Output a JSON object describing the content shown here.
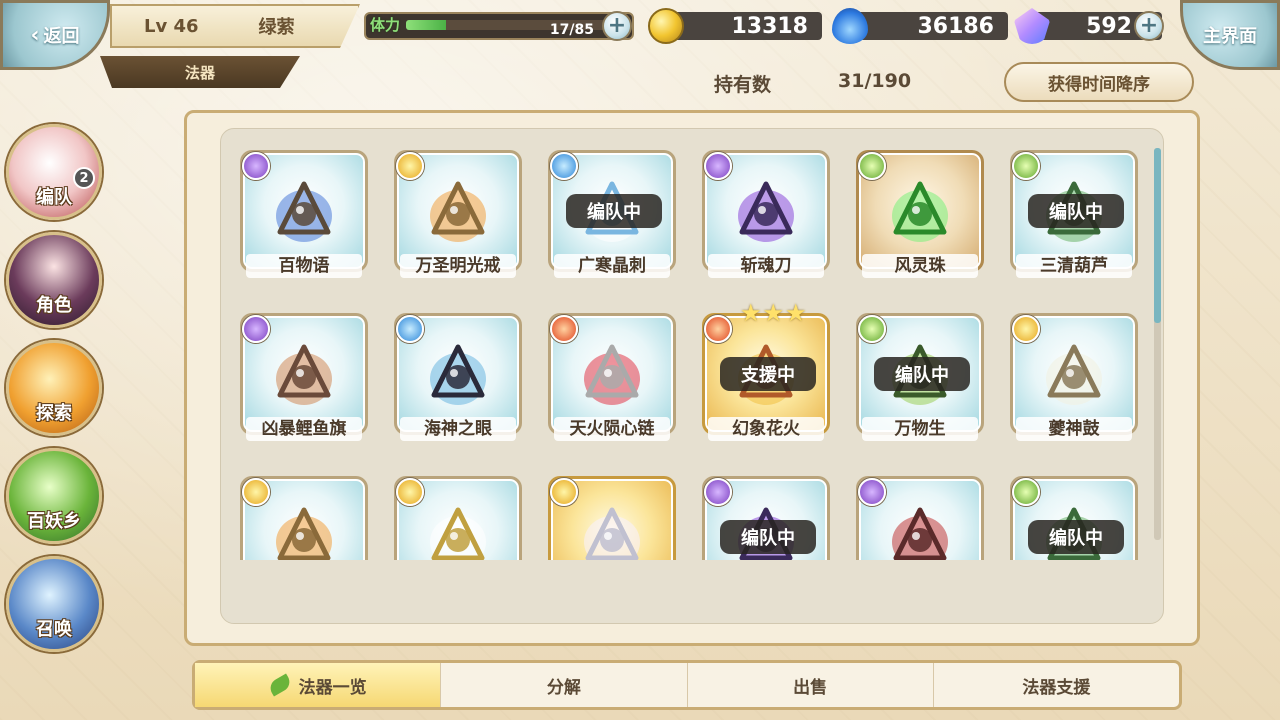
{
  "header": {
    "back_label": "返回",
    "level": "Lv 46",
    "player_name": "绿萦",
    "section_title": "法器",
    "stamina_label": "体力",
    "stamina_value": "17/85",
    "stamina_fraction": 0.2,
    "gold": "13318",
    "soul": "36186",
    "crystal": "592",
    "main_label": "主界面"
  },
  "toolbar": {
    "holdings_label": "持有数",
    "holdings_value": "31/190",
    "sort_label": "获得时间降序"
  },
  "sidebar": {
    "items": [
      {
        "label": "编队",
        "icon": "team-icon",
        "badge": "2"
      },
      {
        "label": "角色",
        "icon": "character-icon"
      },
      {
        "label": "探索",
        "icon": "explore-icon"
      },
      {
        "label": "百妖乡",
        "icon": "village-icon"
      },
      {
        "label": "召唤",
        "icon": "summon-icon"
      }
    ]
  },
  "items": [
    {
      "name": "百物语",
      "element": "dark",
      "status": "",
      "icon": "candle-icon",
      "frame": "blue"
    },
    {
      "name": "万圣明光戒",
      "element": "light",
      "status": "",
      "icon": "ring-icon",
      "frame": "blue"
    },
    {
      "name": "广寒晶刺",
      "element": "water",
      "status": "编队中",
      "icon": "ice-spike-icon",
      "frame": "blue"
    },
    {
      "name": "斩魂刀",
      "element": "dark",
      "status": "",
      "icon": "blade-icon",
      "frame": "blue"
    },
    {
      "name": "风灵珠",
      "element": "wind",
      "status": "",
      "icon": "orb-icon",
      "frame": "tan"
    },
    {
      "name": "三清葫芦",
      "element": "wind",
      "status": "编队中",
      "icon": "gourd-icon",
      "frame": "blue"
    },
    {
      "name": "凶暴鲤鱼旗",
      "element": "dark",
      "status": "",
      "icon": "carp-flag-icon",
      "frame": "blue"
    },
    {
      "name": "海神之眼",
      "element": "water",
      "status": "",
      "icon": "eye-icon",
      "frame": "blue"
    },
    {
      "name": "天火陨心链",
      "element": "fire",
      "status": "",
      "icon": "chain-icon",
      "frame": "blue"
    },
    {
      "name": "幻象花火",
      "element": "fire",
      "status": "支援中",
      "icon": "firework-icon",
      "frame": "gold",
      "stars": "★★★"
    },
    {
      "name": "万物生",
      "element": "wind",
      "status": "编队中",
      "icon": "sprout-icon",
      "frame": "blue"
    },
    {
      "name": "夔神鼓",
      "element": "light",
      "status": "",
      "icon": "drum-icon",
      "frame": "blue"
    },
    {
      "name": "",
      "element": "light",
      "status": "",
      "icon": "ring-icon",
      "frame": "blue"
    },
    {
      "name": "",
      "element": "light",
      "status": "",
      "icon": "sun-mirror-icon",
      "frame": "blue"
    },
    {
      "name": "",
      "element": "light",
      "status": "",
      "icon": "pendant-icon",
      "frame": "gold"
    },
    {
      "name": "",
      "element": "dark",
      "status": "编队中",
      "icon": "blade-icon",
      "frame": "blue"
    },
    {
      "name": "",
      "element": "dark",
      "status": "",
      "icon": "boot-icon",
      "frame": "blue"
    },
    {
      "name": "",
      "element": "wind",
      "status": "编队中",
      "icon": "gourd-icon",
      "frame": "blue"
    }
  ],
  "tabs": [
    {
      "label": "法器一览",
      "active": true
    },
    {
      "label": "分解",
      "active": false
    },
    {
      "label": "出售",
      "active": false
    },
    {
      "label": "法器支援",
      "active": false
    }
  ],
  "colors": {
    "accent": "#7ab6c0",
    "stamina": "#8ee07a",
    "active_tab": "#f6d873"
  }
}
